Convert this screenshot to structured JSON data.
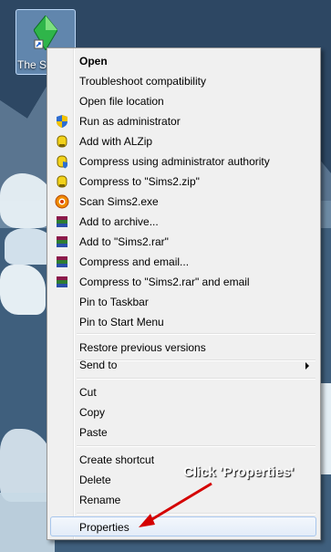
{
  "desktop_icon": {
    "label": "The Si",
    "icon": "sims-plumbob-icon"
  },
  "menu": {
    "items": [
      {
        "label": "Open",
        "bold": true,
        "icon": ""
      },
      {
        "label": "Troubleshoot compatibility",
        "icon": ""
      },
      {
        "label": "Open file location",
        "icon": ""
      },
      {
        "label": "Run as administrator",
        "icon": "uac-shield-icon"
      },
      {
        "label": "Add with ALZip",
        "icon": "alzip-icon"
      },
      {
        "label": "Compress using administrator authority",
        "icon": "alzip-shield-icon"
      },
      {
        "label": "Compress to \"Sims2.zip\"",
        "icon": "alzip-icon"
      },
      {
        "label": "Scan Sims2.exe",
        "icon": "antivirus-icon"
      },
      {
        "label": "Add to archive...",
        "icon": "winrar-icon"
      },
      {
        "label": "Add to \"Sims2.rar\"",
        "icon": "winrar-icon"
      },
      {
        "label": "Compress and email...",
        "icon": "winrar-icon"
      },
      {
        "label": "Compress to \"Sims2.rar\" and email",
        "icon": "winrar-icon"
      },
      {
        "label": "Pin to Taskbar",
        "icon": ""
      },
      {
        "label": "Pin to Start Menu",
        "icon": ""
      },
      {
        "label": "Restore previous versions",
        "icon": ""
      },
      {
        "label": "Send to",
        "icon": "",
        "submenu": true
      },
      {
        "label": "Cut",
        "icon": ""
      },
      {
        "label": "Copy",
        "icon": ""
      },
      {
        "label": "Paste",
        "icon": ""
      },
      {
        "label": "Create shortcut",
        "icon": ""
      },
      {
        "label": "Delete",
        "icon": ""
      },
      {
        "label": "Rename",
        "icon": ""
      },
      {
        "label": "Properties",
        "icon": "",
        "highlighted": true
      }
    ]
  },
  "annotation": {
    "text": "Click 'Properties'",
    "color": "#d40000"
  }
}
